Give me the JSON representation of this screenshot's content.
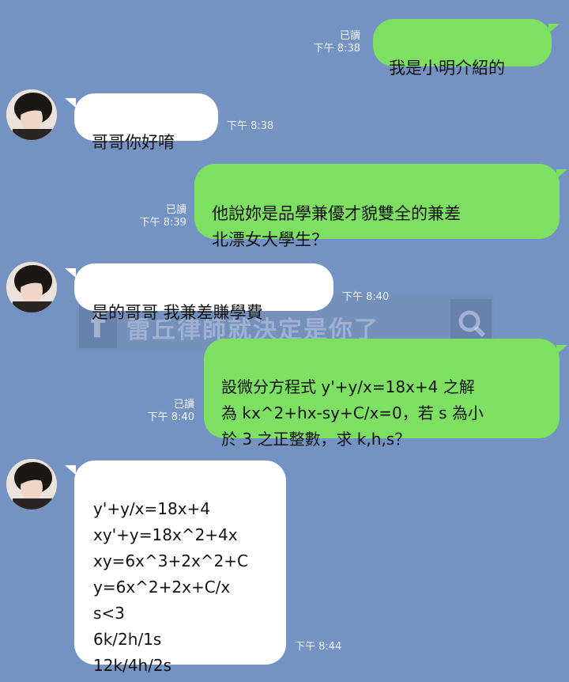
{
  "read_label": "已讀",
  "messages": [
    {
      "side": "out",
      "text": "我是小明介紹的",
      "time": "下午 8:38",
      "read": true
    },
    {
      "side": "in",
      "text": "哥哥你好唷",
      "time": "下午 8:38"
    },
    {
      "side": "out",
      "text": "他說妳是品學兼優才貌雙全的兼差\n北漂女大學生？",
      "time": "下午 8:39",
      "read": true
    },
    {
      "side": "in",
      "text": "是的哥哥 我兼差賺學費",
      "time": "下午 8:40"
    },
    {
      "side": "out",
      "text": "設微分方程式 y'+y/x=18x+4 之解\n為 kx^2+hx-sy+C/x=0，若 s 為小\n於 3 之正整數，求 k,h,s？",
      "time": "下午 8:40",
      "read": true
    },
    {
      "side": "in",
      "text": "y'+y/x=18x+4\nxy'+y=18x^2+4x\nxy=6x^3+2x^2+C\ny=6x^2+2x+C/x\ns<3\n6k/2h/1s\n12k/4h/2s",
      "time": "下午 8:44"
    }
  ],
  "watermark": {
    "text": "雷丘律師就決定是你了",
    "logo": "f"
  }
}
